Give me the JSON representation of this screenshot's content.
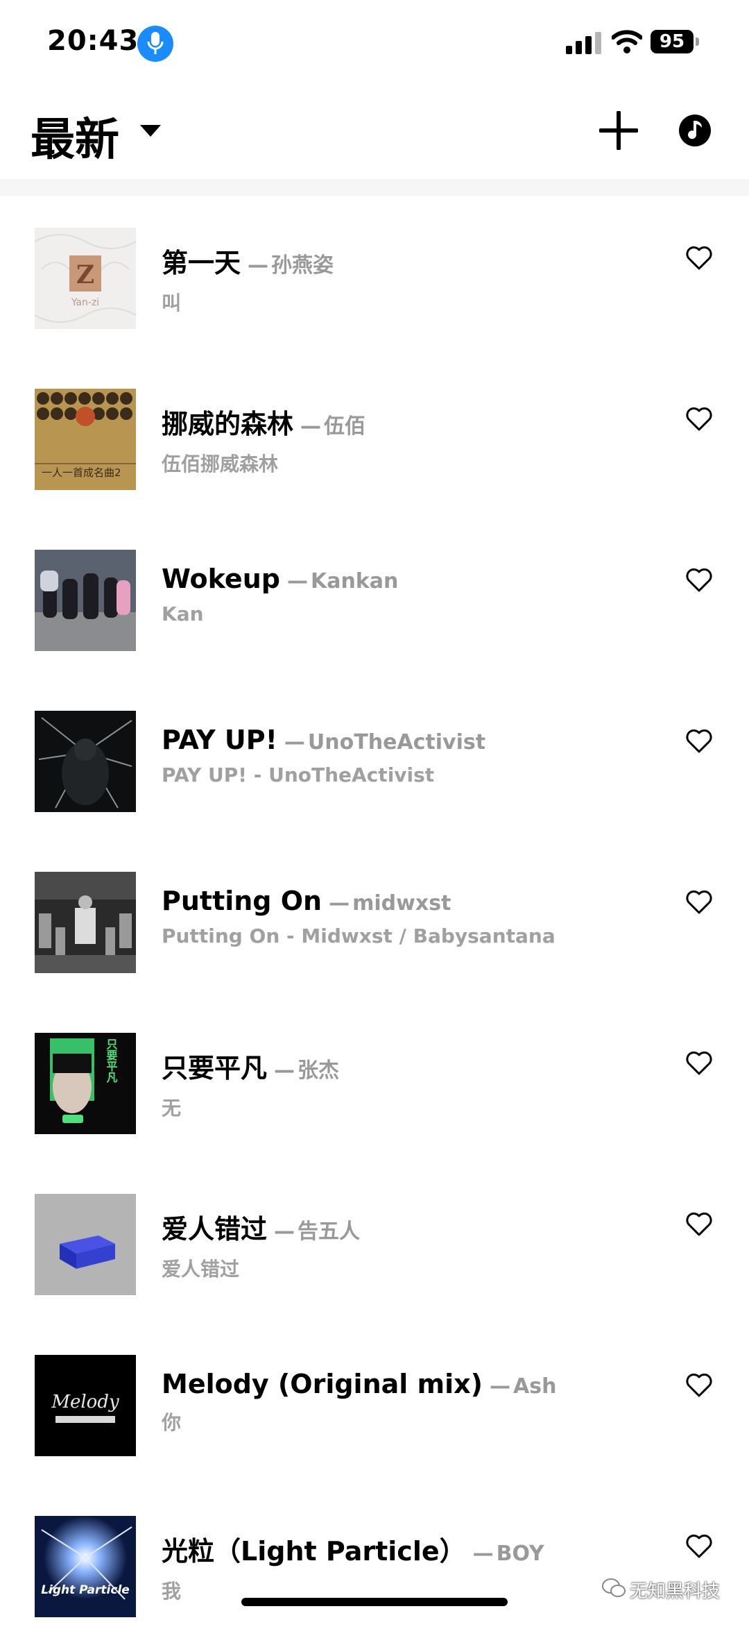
{
  "status_bar": {
    "time": "20:43",
    "battery": "95",
    "mic_color": "#1a8cff"
  },
  "header": {
    "title": "最新"
  },
  "songs": [
    {
      "title": "第一天",
      "artist": "孙燕姿",
      "album": "叫",
      "cover_text": "Yan-zi"
    },
    {
      "title": "挪威的森林",
      "artist": "伍佰",
      "album": "伍佰挪威森林",
      "cover_text": "一人一首成名曲2"
    },
    {
      "title": "Wokeup",
      "artist": "Kankan",
      "album": "Kan"
    },
    {
      "title": "PAY UP!",
      "artist": "UnoTheActivist",
      "album": "PAY UP! - UnoTheActivist"
    },
    {
      "title": "Putting On",
      "artist": "midwxst",
      "album": "Putting On - Midwxst / Babysantana"
    },
    {
      "title": "只要平凡",
      "artist": "张杰",
      "album": "无",
      "cover_text": "只要平凡"
    },
    {
      "title": "爱人错过",
      "artist": "告五人",
      "album": "爱人错过"
    },
    {
      "title": "Melody (Original mix)",
      "artist": "Ash",
      "album": "你",
      "cover_text": "Melody"
    },
    {
      "title": "光粒（Light Particle）",
      "artist": "BOY",
      "album": "我",
      "cover_text": "Light Particle"
    }
  ],
  "watermark": "无知黑科技",
  "colors": {
    "secondary_text": "#999999",
    "divider": "#f6f6f6",
    "accent_blue": "#1a8cff"
  },
  "icons": {
    "add": "plus-icon",
    "music": "music-disc-icon",
    "favorite": "heart-outline-icon",
    "dropdown": "caret-down-icon"
  }
}
